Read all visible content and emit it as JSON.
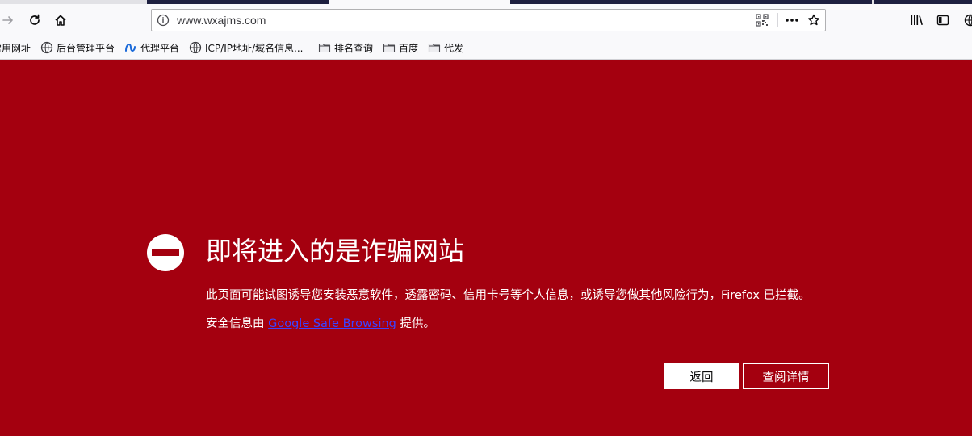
{
  "browser": {
    "url": "www.wxajms.com",
    "icons": {
      "forward": "arrow-right-icon",
      "reload": "reload-icon",
      "home": "home-icon",
      "site_info": "info-icon",
      "qr": "qr-code-icon",
      "page_actions": "more-icon",
      "bookmark_star": "star-icon",
      "library": "library-icon",
      "sidebar": "sidebar-icon",
      "edge": "globe-icon"
    }
  },
  "bookmarks": [
    {
      "label": "常用网址",
      "icon": "none"
    },
    {
      "label": "后台管理平台",
      "icon": "globe-icon"
    },
    {
      "label": "代理平台",
      "icon": "meta-icon"
    },
    {
      "label": "ICP/IP地址/域名信息...",
      "icon": "globe-icon"
    },
    {
      "label": "排名查询",
      "icon": "folder-icon"
    },
    {
      "label": "百度",
      "icon": "folder-icon"
    },
    {
      "label": "代发",
      "icon": "folder-icon"
    }
  ],
  "error_page": {
    "title": "即将进入的是诈骗网站",
    "description": "此页面可能试图诱导您安装恶意软件，透露密码、信用卡号等个人信息，或诱导您做其他风险行为，Firefox 已拦截。",
    "provider_prefix": "安全信息由 ",
    "provider_link": "Google Safe Browsing",
    "provider_suffix": " 提供。",
    "back_button": "返回",
    "details_button": "查阅详情"
  },
  "colors": {
    "page_background": "#a4000f",
    "link": "#3c42ff",
    "toolbar": "#f9f9fb"
  }
}
